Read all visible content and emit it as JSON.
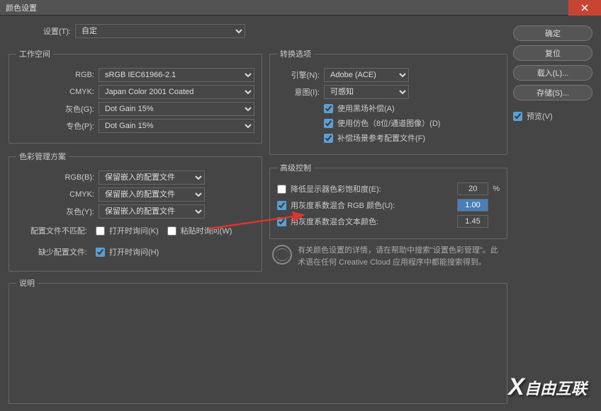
{
  "title": "颜色设置",
  "settings": {
    "label": "设置(T):",
    "value": "自定"
  },
  "workspace": {
    "legend": "工作空间",
    "rgb_label": "RGB:",
    "rgb_value": "sRGB IEC61966-2.1",
    "cmyk_label": "CMYK:",
    "cmyk_value": "Japan Color 2001 Coated",
    "gray_label": "灰色(G):",
    "gray_value": "Dot Gain 15%",
    "spot_label": "专色(P):",
    "spot_value": "Dot Gain 15%"
  },
  "policy": {
    "legend": "色彩管理方案",
    "rgb_label": "RGB(B):",
    "rgb_value": "保留嵌入的配置文件",
    "cmyk_label": "CMYK:",
    "cmyk_value": "保留嵌入的配置文件",
    "gray_label": "灰色(Y):",
    "gray_value": "保留嵌入的配置文件",
    "mismatch_label": "配置文件不匹配:",
    "open_ask": "打开时询问(K)",
    "paste_ask": "粘贴时询问(W)",
    "missing_label": "缺少配置文件:",
    "open_ask2": "打开时询问(H)"
  },
  "convert": {
    "legend": "转换选项",
    "engine_label": "引擎(N):",
    "engine_value": "Adobe (ACE)",
    "intent_label": "意图(I):",
    "intent_value": "可感知",
    "black_point": "使用黑场补偿(A)",
    "dither": "使用仿色（8位/通道图像）(D)",
    "compensate": "补偿场景参考配置文件(F)"
  },
  "advanced": {
    "legend": "高级控制",
    "desat_label": "降低显示器色彩饱和度(E):",
    "desat_value": "20",
    "desat_unit": "%",
    "blend_rgb_label": "用灰度系数混合 RGB 颜色(U):",
    "blend_rgb_value": "1.00",
    "blend_text_label": "用灰度系数混合文本颜色:",
    "blend_text_value": "1.45"
  },
  "info_text": "有关颜色设置的详情，请在帮助中搜索\"设置色彩管理\"。此术语在任何 Creative Cloud 应用程序中都能搜索得到。",
  "desc": {
    "legend": "说明"
  },
  "buttons": {
    "ok": "确定",
    "reset": "复位",
    "load": "载入(L)...",
    "save": "存储(S)...",
    "preview": "预览(V)"
  },
  "watermark": "自由互联"
}
